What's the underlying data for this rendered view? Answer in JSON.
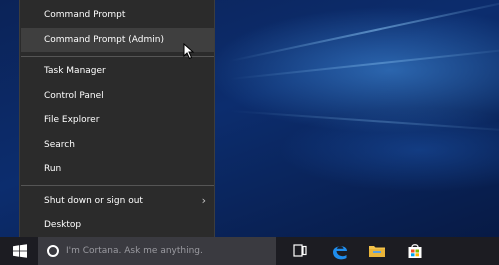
{
  "menu": {
    "items": [
      {
        "label": "Command Prompt"
      },
      {
        "label": "Command Prompt (Admin)"
      },
      {
        "label": "Task Manager"
      },
      {
        "label": "Control Panel"
      },
      {
        "label": "File Explorer"
      },
      {
        "label": "Search"
      },
      {
        "label": "Run"
      },
      {
        "label": "Shut down or sign out"
      },
      {
        "label": "Desktop"
      }
    ],
    "highlighted_index": 1
  },
  "taskbar": {
    "search_placeholder": "I'm Cortana. Ask me anything.",
    "icons": [
      "start-windows-icon",
      "cortana-icon",
      "task-view-icon",
      "edge-icon",
      "file-explorer-icon",
      "store-icon"
    ]
  },
  "colors": {
    "menu_bg": "#2b2b2b",
    "menu_highlight": "#3f3f3f",
    "taskbar_bg": "#1c1c22",
    "edge_blue": "#1f8ded",
    "folder_yellow": "#f3c24a"
  }
}
